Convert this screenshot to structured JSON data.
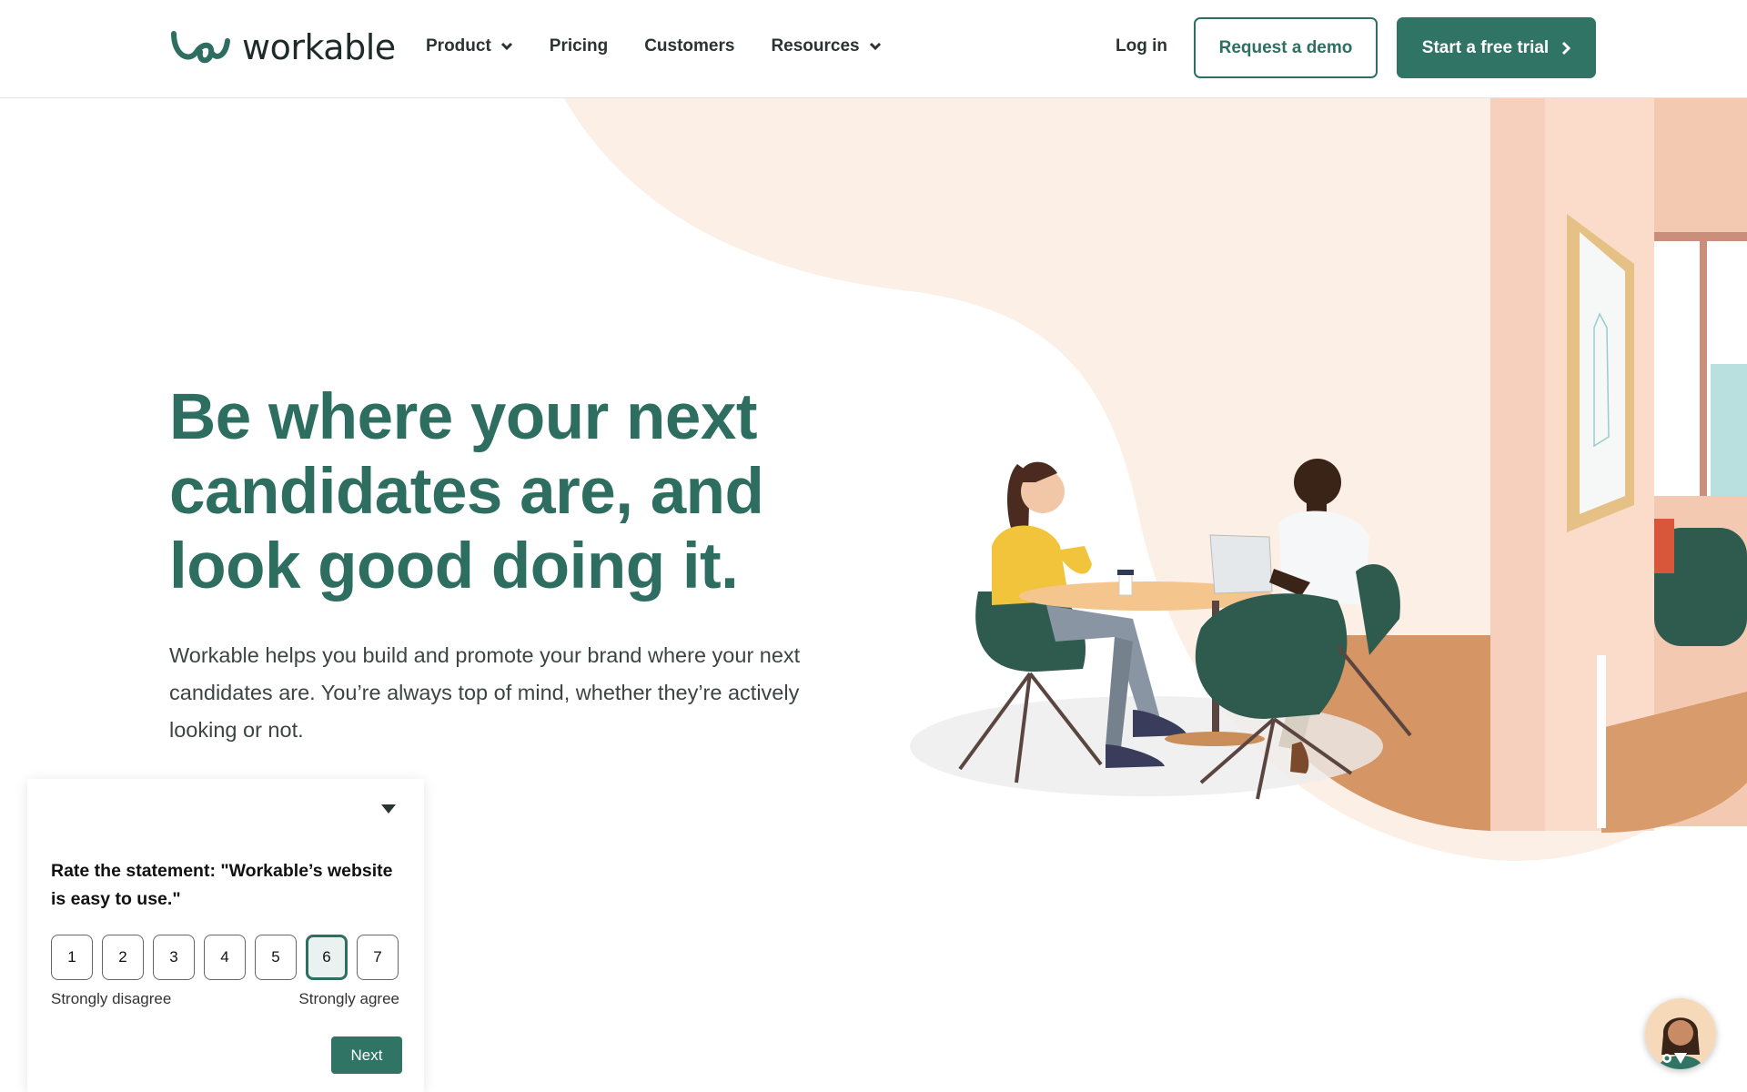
{
  "header": {
    "logo_text": "workable",
    "nav": [
      {
        "label": "Product",
        "has_dropdown": true
      },
      {
        "label": "Pricing",
        "has_dropdown": false
      },
      {
        "label": "Customers",
        "has_dropdown": false
      },
      {
        "label": "Resources",
        "has_dropdown": true
      }
    ],
    "login_label": "Log in",
    "demo_label": "Request a demo",
    "trial_label": "Start a free trial"
  },
  "hero": {
    "title": "Be where your next candidates are, and look good doing it.",
    "subtitle": "Workable helps you build and promote your brand where your next candidates are. You’re always top of mind, whether they’re actively looking or not."
  },
  "survey": {
    "question": "Rate the statement: \"Workable’s website is easy to use.\"",
    "options": [
      "1",
      "2",
      "3",
      "4",
      "5",
      "6",
      "7"
    ],
    "selected": "6",
    "label_left": "Strongly disagree",
    "label_right": "Strongly agree",
    "next_label": "Next"
  },
  "colors": {
    "brand": "#2f7465",
    "hero_blob": "#fcefe5",
    "wall": "#fbe1d2",
    "floor": "#d99a6c"
  },
  "icons": {
    "dropdown": "chevron-down-icon",
    "trial_arrow": "chevron-right-icon",
    "survey_toggle": "caret-down-icon"
  }
}
